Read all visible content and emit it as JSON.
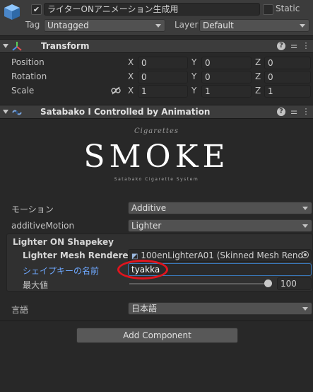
{
  "gameobject": {
    "name": "ライターONアニメーション生成用",
    "static_label": "Static",
    "tag_label": "Tag",
    "tag_value": "Untagged",
    "layer_label": "Layer",
    "layer_value": "Default"
  },
  "transform": {
    "title": "Transform",
    "rows": [
      {
        "label": "Position",
        "x": "0",
        "y": "0",
        "z": "0"
      },
      {
        "label": "Rotation",
        "x": "0",
        "y": "0",
        "z": "0"
      },
      {
        "label": "Scale",
        "x": "1",
        "y": "1",
        "z": "1"
      }
    ],
    "axes": [
      "X",
      "Y",
      "Z"
    ]
  },
  "component": {
    "title": "Satabako I Controlled by Animation",
    "logo_text": "SMOKE",
    "logo_script": "Cigarettes",
    "logo_subtitle": "Satabako Cigarette System",
    "motion_label": "モーション",
    "motion_value": "Additive",
    "additive_label": "additiveMotion",
    "additive_value": "Lighter",
    "section_title": "Lighter ON Shapekey",
    "renderer_label": "Lighter Mesh Renderer",
    "renderer_value": "100enLighterA01 (Skinned Mesh Rend",
    "shapekey_label": "シェイプキーの名前",
    "shapekey_value": "tyakka",
    "max_label": "最大値",
    "max_value": "100",
    "max_fraction": 1.0,
    "lang_label": "言語",
    "lang_value": "日本語"
  },
  "add_component": "Add Component",
  "colors": {
    "highlight_label": "#6ea8ff",
    "annotation_ring": "#e0141e"
  }
}
